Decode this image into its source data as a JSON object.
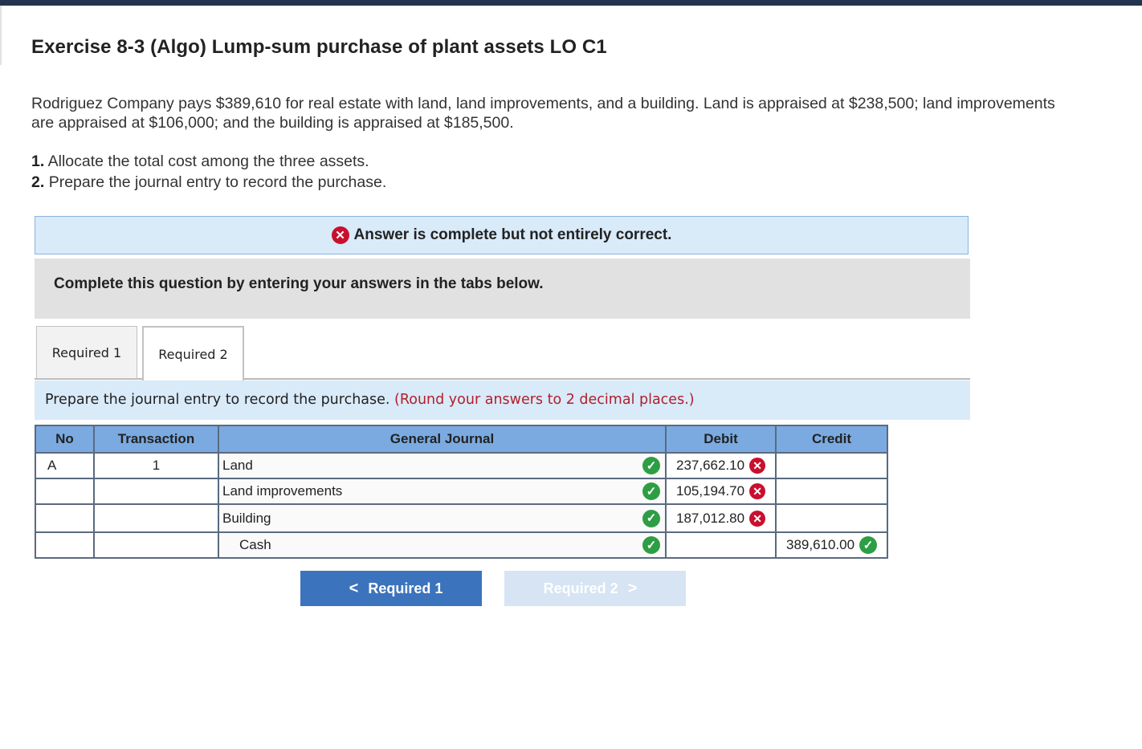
{
  "title": "Exercise 8-3 (Algo) Lump-sum purchase of plant assets LO C1",
  "intro": "Rodriguez Company pays $389,610 for real estate with land, land improvements, and a building. Land is appraised at $238,500; land improvements are appraised at $106,000; and the building is appraised at $185,500.",
  "steps": [
    {
      "num": "1.",
      "text": "Allocate the total cost among the three assets."
    },
    {
      "num": "2.",
      "text": "Prepare the journal entry to record the purchase."
    }
  ],
  "feedback": {
    "text": "Answer is complete but not entirely correct.",
    "icon": "x-circle-icon",
    "color": "#c8102e"
  },
  "instruction": "Complete this question by entering your answers in the tabs below.",
  "tabs": [
    "Required 1",
    "Required 2"
  ],
  "prompt": {
    "text": "Prepare the journal entry to record the purchase.",
    "note": "(Round your answers to 2 decimal places.)"
  },
  "table": {
    "headers": [
      "No",
      "Transaction",
      "General Journal",
      "Debit",
      "Credit"
    ],
    "rows": [
      {
        "no": "A",
        "transaction": "1",
        "account": "Land",
        "account_status": "correct",
        "debit": "237,662.10",
        "debit_status": "incorrect",
        "credit": "",
        "credit_status": ""
      },
      {
        "no": "",
        "transaction": "",
        "account": "Land improvements",
        "account_status": "correct",
        "debit": "105,194.70",
        "debit_status": "incorrect",
        "credit": "",
        "credit_status": ""
      },
      {
        "no": "",
        "transaction": "",
        "account": "Building",
        "account_status": "correct",
        "debit": "187,012.80",
        "debit_status": "incorrect",
        "credit": "",
        "credit_status": ""
      },
      {
        "no": "",
        "transaction": "",
        "account": "Cash",
        "account_status": "correct",
        "debit": "",
        "debit_status": "",
        "credit": "389,610.00",
        "credit_status": "correct"
      }
    ]
  },
  "nav": {
    "prev": "Required 1",
    "next": "Required 2"
  },
  "colors": {
    "correct": "#2e9e44",
    "incorrect": "#c8102e",
    "header": "#7aaae0",
    "nav_active": "#3b74bc"
  }
}
